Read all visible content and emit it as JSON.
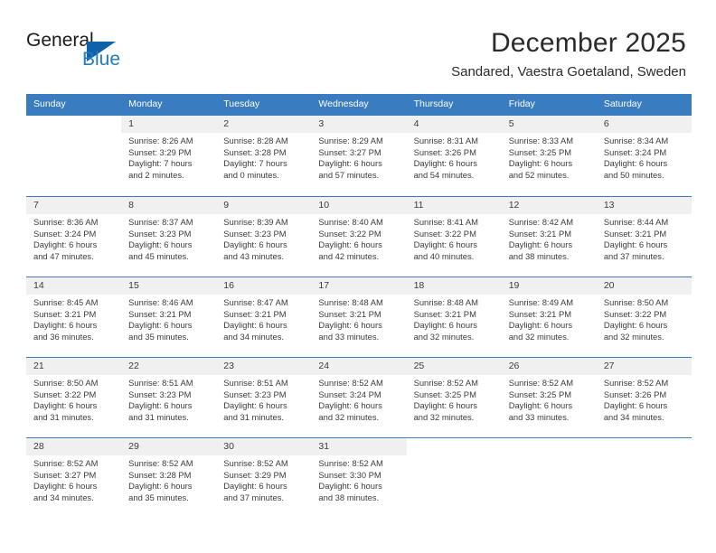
{
  "brand": {
    "name_part1": "General",
    "name_part2": "Blue",
    "accent_color": "#0f62a8",
    "blue_text_color": "#1f7bc1"
  },
  "header": {
    "title": "December 2025",
    "subtitle": "Sandared, Vaestra Goetaland, Sweden"
  },
  "calendar": {
    "header_bg": "#3a7cc0",
    "daynum_bg": "#f0f0f0",
    "weekdays": [
      "Sunday",
      "Monday",
      "Tuesday",
      "Wednesday",
      "Thursday",
      "Friday",
      "Saturday"
    ],
    "weeks": [
      [
        {
          "day": "",
          "empty": true
        },
        {
          "day": "1",
          "sunrise": "Sunrise: 8:26 AM",
          "sunset": "Sunset: 3:29 PM",
          "daylight_1": "Daylight: 7 hours",
          "daylight_2": "and 2 minutes."
        },
        {
          "day": "2",
          "sunrise": "Sunrise: 8:28 AM",
          "sunset": "Sunset: 3:28 PM",
          "daylight_1": "Daylight: 7 hours",
          "daylight_2": "and 0 minutes."
        },
        {
          "day": "3",
          "sunrise": "Sunrise: 8:29 AM",
          "sunset": "Sunset: 3:27 PM",
          "daylight_1": "Daylight: 6 hours",
          "daylight_2": "and 57 minutes."
        },
        {
          "day": "4",
          "sunrise": "Sunrise: 8:31 AM",
          "sunset": "Sunset: 3:26 PM",
          "daylight_1": "Daylight: 6 hours",
          "daylight_2": "and 54 minutes."
        },
        {
          "day": "5",
          "sunrise": "Sunrise: 8:33 AM",
          "sunset": "Sunset: 3:25 PM",
          "daylight_1": "Daylight: 6 hours",
          "daylight_2": "and 52 minutes."
        },
        {
          "day": "6",
          "sunrise": "Sunrise: 8:34 AM",
          "sunset": "Sunset: 3:24 PM",
          "daylight_1": "Daylight: 6 hours",
          "daylight_2": "and 50 minutes."
        }
      ],
      [
        {
          "day": "7",
          "sunrise": "Sunrise: 8:36 AM",
          "sunset": "Sunset: 3:24 PM",
          "daylight_1": "Daylight: 6 hours",
          "daylight_2": "and 47 minutes."
        },
        {
          "day": "8",
          "sunrise": "Sunrise: 8:37 AM",
          "sunset": "Sunset: 3:23 PM",
          "daylight_1": "Daylight: 6 hours",
          "daylight_2": "and 45 minutes."
        },
        {
          "day": "9",
          "sunrise": "Sunrise: 8:39 AM",
          "sunset": "Sunset: 3:23 PM",
          "daylight_1": "Daylight: 6 hours",
          "daylight_2": "and 43 minutes."
        },
        {
          "day": "10",
          "sunrise": "Sunrise: 8:40 AM",
          "sunset": "Sunset: 3:22 PM",
          "daylight_1": "Daylight: 6 hours",
          "daylight_2": "and 42 minutes."
        },
        {
          "day": "11",
          "sunrise": "Sunrise: 8:41 AM",
          "sunset": "Sunset: 3:22 PM",
          "daylight_1": "Daylight: 6 hours",
          "daylight_2": "and 40 minutes."
        },
        {
          "day": "12",
          "sunrise": "Sunrise: 8:42 AM",
          "sunset": "Sunset: 3:21 PM",
          "daylight_1": "Daylight: 6 hours",
          "daylight_2": "and 38 minutes."
        },
        {
          "day": "13",
          "sunrise": "Sunrise: 8:44 AM",
          "sunset": "Sunset: 3:21 PM",
          "daylight_1": "Daylight: 6 hours",
          "daylight_2": "and 37 minutes."
        }
      ],
      [
        {
          "day": "14",
          "sunrise": "Sunrise: 8:45 AM",
          "sunset": "Sunset: 3:21 PM",
          "daylight_1": "Daylight: 6 hours",
          "daylight_2": "and 36 minutes."
        },
        {
          "day": "15",
          "sunrise": "Sunrise: 8:46 AM",
          "sunset": "Sunset: 3:21 PM",
          "daylight_1": "Daylight: 6 hours",
          "daylight_2": "and 35 minutes."
        },
        {
          "day": "16",
          "sunrise": "Sunrise: 8:47 AM",
          "sunset": "Sunset: 3:21 PM",
          "daylight_1": "Daylight: 6 hours",
          "daylight_2": "and 34 minutes."
        },
        {
          "day": "17",
          "sunrise": "Sunrise: 8:48 AM",
          "sunset": "Sunset: 3:21 PM",
          "daylight_1": "Daylight: 6 hours",
          "daylight_2": "and 33 minutes."
        },
        {
          "day": "18",
          "sunrise": "Sunrise: 8:48 AM",
          "sunset": "Sunset: 3:21 PM",
          "daylight_1": "Daylight: 6 hours",
          "daylight_2": "and 32 minutes."
        },
        {
          "day": "19",
          "sunrise": "Sunrise: 8:49 AM",
          "sunset": "Sunset: 3:21 PM",
          "daylight_1": "Daylight: 6 hours",
          "daylight_2": "and 32 minutes."
        },
        {
          "day": "20",
          "sunrise": "Sunrise: 8:50 AM",
          "sunset": "Sunset: 3:22 PM",
          "daylight_1": "Daylight: 6 hours",
          "daylight_2": "and 32 minutes."
        }
      ],
      [
        {
          "day": "21",
          "sunrise": "Sunrise: 8:50 AM",
          "sunset": "Sunset: 3:22 PM",
          "daylight_1": "Daylight: 6 hours",
          "daylight_2": "and 31 minutes."
        },
        {
          "day": "22",
          "sunrise": "Sunrise: 8:51 AM",
          "sunset": "Sunset: 3:23 PM",
          "daylight_1": "Daylight: 6 hours",
          "daylight_2": "and 31 minutes."
        },
        {
          "day": "23",
          "sunrise": "Sunrise: 8:51 AM",
          "sunset": "Sunset: 3:23 PM",
          "daylight_1": "Daylight: 6 hours",
          "daylight_2": "and 31 minutes."
        },
        {
          "day": "24",
          "sunrise": "Sunrise: 8:52 AM",
          "sunset": "Sunset: 3:24 PM",
          "daylight_1": "Daylight: 6 hours",
          "daylight_2": "and 32 minutes."
        },
        {
          "day": "25",
          "sunrise": "Sunrise: 8:52 AM",
          "sunset": "Sunset: 3:25 PM",
          "daylight_1": "Daylight: 6 hours",
          "daylight_2": "and 32 minutes."
        },
        {
          "day": "26",
          "sunrise": "Sunrise: 8:52 AM",
          "sunset": "Sunset: 3:25 PM",
          "daylight_1": "Daylight: 6 hours",
          "daylight_2": "and 33 minutes."
        },
        {
          "day": "27",
          "sunrise": "Sunrise: 8:52 AM",
          "sunset": "Sunset: 3:26 PM",
          "daylight_1": "Daylight: 6 hours",
          "daylight_2": "and 34 minutes."
        }
      ],
      [
        {
          "day": "28",
          "sunrise": "Sunrise: 8:52 AM",
          "sunset": "Sunset: 3:27 PM",
          "daylight_1": "Daylight: 6 hours",
          "daylight_2": "and 34 minutes."
        },
        {
          "day": "29",
          "sunrise": "Sunrise: 8:52 AM",
          "sunset": "Sunset: 3:28 PM",
          "daylight_1": "Daylight: 6 hours",
          "daylight_2": "and 35 minutes."
        },
        {
          "day": "30",
          "sunrise": "Sunrise: 8:52 AM",
          "sunset": "Sunset: 3:29 PM",
          "daylight_1": "Daylight: 6 hours",
          "daylight_2": "and 37 minutes."
        },
        {
          "day": "31",
          "sunrise": "Sunrise: 8:52 AM",
          "sunset": "Sunset: 3:30 PM",
          "daylight_1": "Daylight: 6 hours",
          "daylight_2": "and 38 minutes."
        },
        {
          "day": "",
          "empty": true
        },
        {
          "day": "",
          "empty": true
        },
        {
          "day": "",
          "empty": true
        }
      ]
    ]
  }
}
